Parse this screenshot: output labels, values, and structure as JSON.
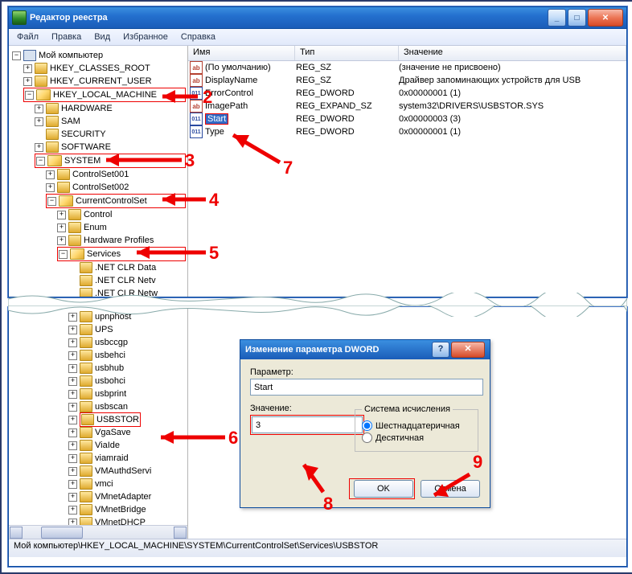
{
  "window": {
    "title": "Редактор реестра",
    "menus": [
      "Файл",
      "Правка",
      "Вид",
      "Избранное",
      "Справка"
    ]
  },
  "tree": {
    "root": "Мой компьютер",
    "l1": [
      "HKEY_CLASSES_ROOT",
      "HKEY_CURRENT_USER",
      "HKEY_LOCAL_MACHINE"
    ],
    "hklm_children": [
      "HARDWARE",
      "SAM",
      "SECURITY",
      "SOFTWARE",
      "SYSTEM"
    ],
    "system_children": [
      "ControlSet001",
      "ControlSet002",
      "CurrentControlSet"
    ],
    "ccs_children": [
      "Control",
      "Enum",
      "Hardware Profiles",
      "Services"
    ],
    "services_children": [
      ".NET CLR Data",
      ".NET CLR Netv",
      ".NET CLR Netw"
    ],
    "bottom": [
      "upnphost",
      "UPS",
      "usbccgp",
      "usbehci",
      "usbhub",
      "usbohci",
      "usbprint",
      "usbscan",
      "USBSTOR",
      "VgaSave",
      "ViaIde",
      "viamraid",
      "VMAuthdServi",
      "vmci",
      "VMnetAdapter",
      "VMnetBridge",
      "VMnetDHCP"
    ]
  },
  "list": {
    "cols": {
      "c1": "Имя",
      "c2": "Тип",
      "c3": "Значение"
    },
    "rows": [
      {
        "kind": "ab",
        "name": "(По умолчанию)",
        "type": "REG_SZ",
        "value": "(значение не присвоено)"
      },
      {
        "kind": "ab",
        "name": "DisplayName",
        "type": "REG_SZ",
        "value": "Драйвер запоминающих устройств для USB"
      },
      {
        "kind": "bin",
        "name": "ErrorControl",
        "type": "REG_DWORD",
        "value": "0x00000001 (1)"
      },
      {
        "kind": "ab",
        "name": "ImagePath",
        "type": "REG_EXPAND_SZ",
        "value": "system32\\DRIVERS\\USBSTOR.SYS"
      },
      {
        "kind": "bin",
        "name": "Start",
        "type": "REG_DWORD",
        "value": "0x00000003 (3)",
        "sel": true,
        "hl": true
      },
      {
        "kind": "bin",
        "name": "Type",
        "type": "REG_DWORD",
        "value": "0x00000001 (1)"
      }
    ]
  },
  "statusbar": "Мой компьютер\\HKEY_LOCAL_MACHINE\\SYSTEM\\CurrentControlSet\\Services\\USBSTOR",
  "dialog": {
    "title": "Изменение параметра DWORD",
    "paramLabel": "Параметр:",
    "paramValue": "Start",
    "valueLabel": "Значение:",
    "valueValue": "3",
    "baseLabel": "Система исчисления",
    "radioHex": "Шестнадцатеричная",
    "radioDec": "Десятичная",
    "ok": "OK",
    "cancel": "Отмена"
  },
  "annotations": {
    "n2": "2",
    "n3": "3",
    "n4": "4",
    "n5": "5",
    "n6": "6",
    "n7": "7",
    "n8": "8",
    "n9": "9"
  }
}
